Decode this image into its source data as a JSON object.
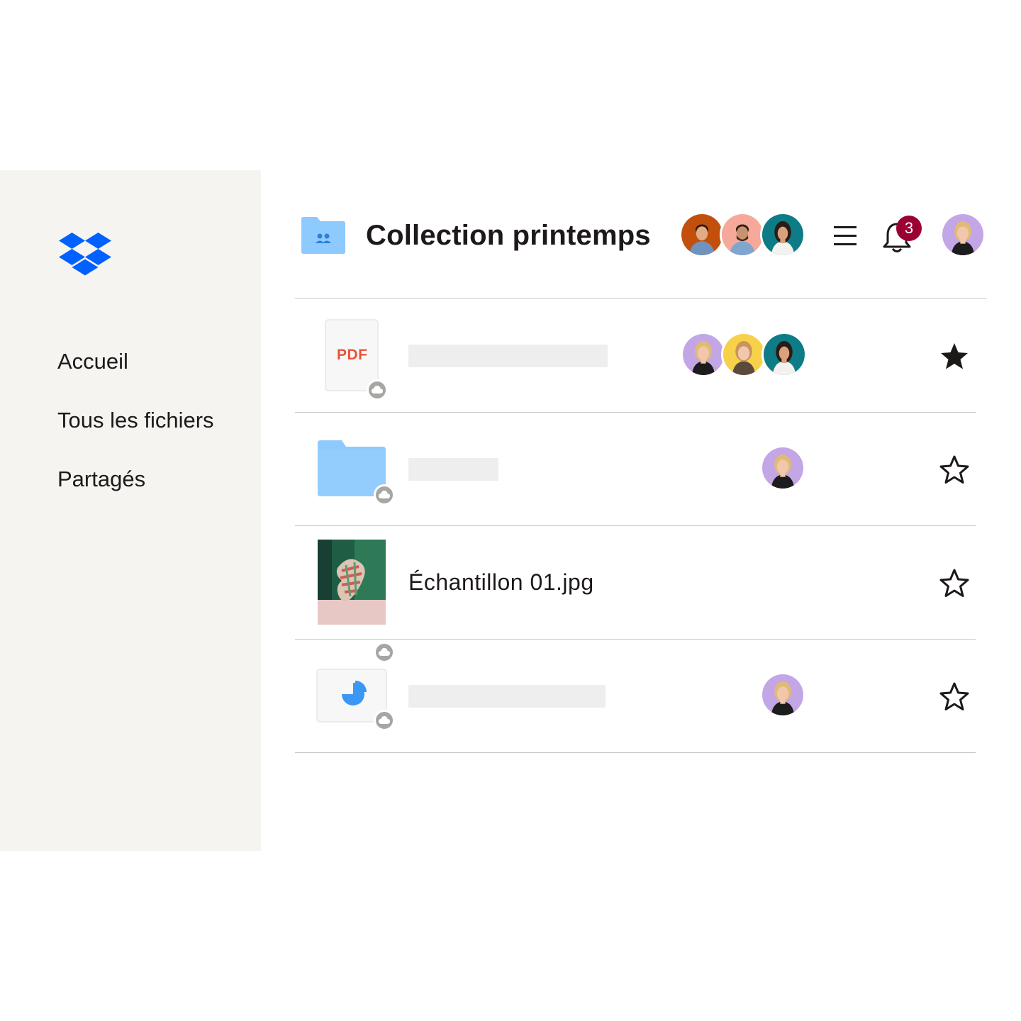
{
  "sidebar": {
    "logo_icon": "dropbox-logo",
    "items": [
      {
        "label": "Accueil"
      },
      {
        "label": "Tous les fichiers"
      },
      {
        "label": "Partagés"
      }
    ]
  },
  "header": {
    "folder_icon": "shared-folder-icon",
    "title": "Collection printemps",
    "shared_with_avatars": 3,
    "menu_icon": "hamburger-menu-icon",
    "notifications": {
      "icon": "bell-icon",
      "count": "3"
    },
    "account_avatar": "user-avatar"
  },
  "files": [
    {
      "type": "pdf",
      "icon_label": "PDF",
      "name": "",
      "avatars": 3,
      "starred": true,
      "synced": true
    },
    {
      "type": "folder",
      "name": "",
      "avatars": 1,
      "starred": false,
      "synced": true
    },
    {
      "type": "image",
      "name": "Échantillon 01.jpg",
      "avatars": 0,
      "starred": false,
      "synced": true
    },
    {
      "type": "chart-document",
      "name": "",
      "avatars": 1,
      "starred": false,
      "synced": true
    }
  ],
  "colors": {
    "brand": "#0061fe",
    "sidebar_bg": "#f5f4f1",
    "folder": "#8ecafe",
    "pdf_label": "#e8533a",
    "notification_badge": "#9b0032"
  }
}
